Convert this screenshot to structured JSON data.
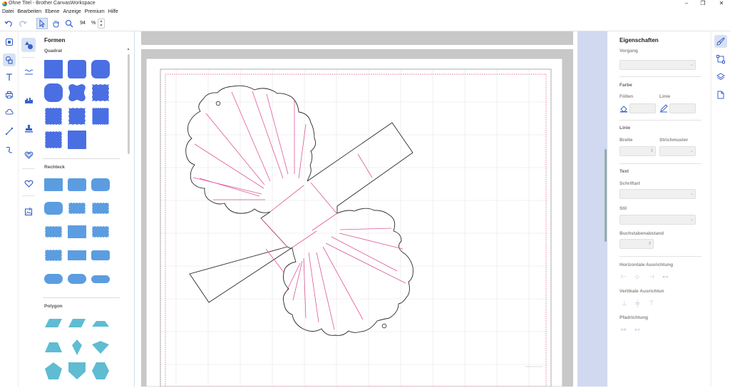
{
  "window": {
    "title": "Ohne Titel - Brother CanvasWorkspace",
    "minimize": "–",
    "restore": "❐",
    "close": "✕"
  },
  "menu": [
    "Datei",
    "Bearbeiten",
    "Ebene",
    "Anzeige",
    "Premium",
    "Hilfe"
  ],
  "toolbar": {
    "zoom_value": "94",
    "zoom_unit": "%"
  },
  "shapes_panel": {
    "title": "Formen",
    "sections": {
      "square": "Quadrat",
      "rect": "Rechteck",
      "polygon": "Polygon"
    }
  },
  "properties": {
    "title": "Eigenschaften",
    "vorgang": "Vorgang",
    "farbe": "Farbe",
    "fuellen": "Füllen",
    "linie_label": "Linie",
    "linie_section": "Linie",
    "breite": "Breite",
    "strichmuster": "Strichmuster",
    "text_section": "Text",
    "schriftart": "Schriftart",
    "stil": "Stil",
    "buchstabenabstand": "Buchstabenabstand",
    "horizontale": "Horizontale Ausrichtung",
    "vertikale": "Vertikale Ausrichtun",
    "pfadrichtung": "Pfadrichtung"
  },
  "colors": {
    "accent": "#4a6fe3",
    "shape_blue": "#5b9de0",
    "shape_teal": "#5fbcd3",
    "score_line": "#e0559a"
  }
}
